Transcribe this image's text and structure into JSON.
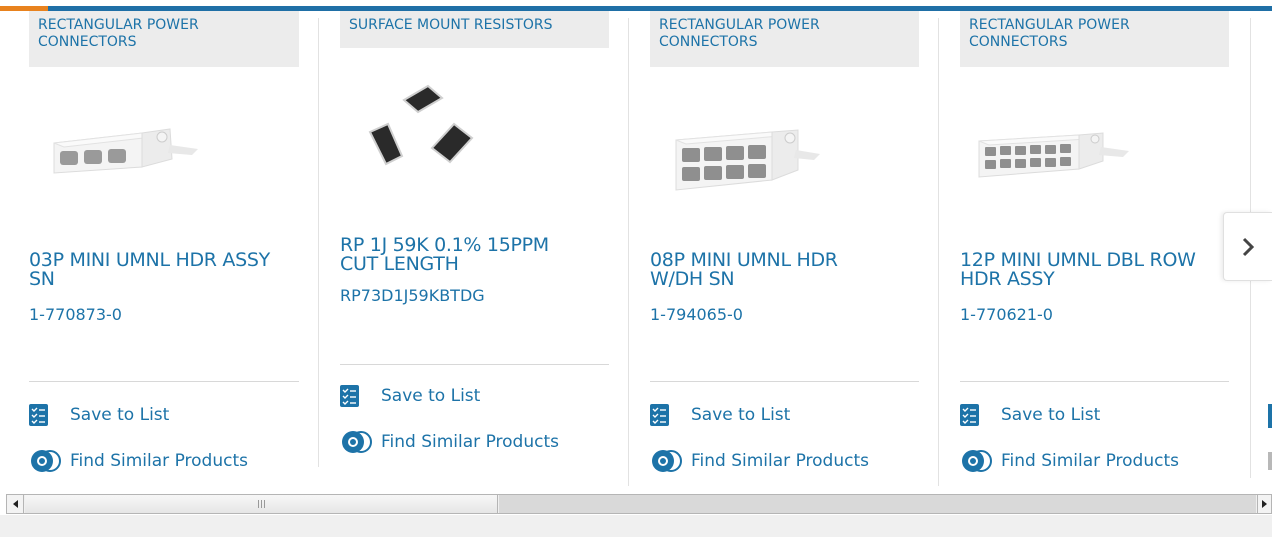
{
  "carousel": {
    "cards": [
      {
        "category": "RECTANGULAR POWER CONNECTORS",
        "name_line1": "03P MINI UMNL HDR ASSY",
        "name_line2": "SN",
        "part_number": "1-770873-0",
        "save_label": "Save to List",
        "similar_label": "Find Similar Products",
        "image": "connector-3-pin"
      },
      {
        "category": "SURFACE MOUNT RESISTORS",
        "name_line1": "RP 1J 59K 0.1% 15PPM",
        "name_line2": "CUT LENGTH",
        "part_number": "RP73D1J59KBTDG",
        "save_label": "Save to List",
        "similar_label": "Find Similar Products",
        "image": "smd-resistors"
      },
      {
        "category": "RECTANGULAR POWER CONNECTORS",
        "name_line1": "08P MINI UMNL HDR",
        "name_line2": "W/DH SN",
        "part_number": "1-794065-0",
        "save_label": "Save to List",
        "similar_label": "Find Similar Products",
        "image": "connector-8-pin"
      },
      {
        "category": "RECTANGULAR POWER CONNECTORS",
        "name_line1": "12P MINI UMNL DBL ROW",
        "name_line2": "HDR ASSY",
        "part_number": "1-770621-0",
        "save_label": "Save to List",
        "similar_label": "Find Similar Products",
        "image": "connector-12-pin"
      }
    ],
    "next_icon": "chevron-right-icon"
  },
  "colors": {
    "link": "#1d73a8",
    "accent_bar": "#1f6fa6",
    "accent_orange": "#e8821e",
    "category_bg": "#ececec"
  },
  "scrollbar": {
    "left_icon": "arrow-left-icon",
    "right_icon": "arrow-right-icon"
  }
}
